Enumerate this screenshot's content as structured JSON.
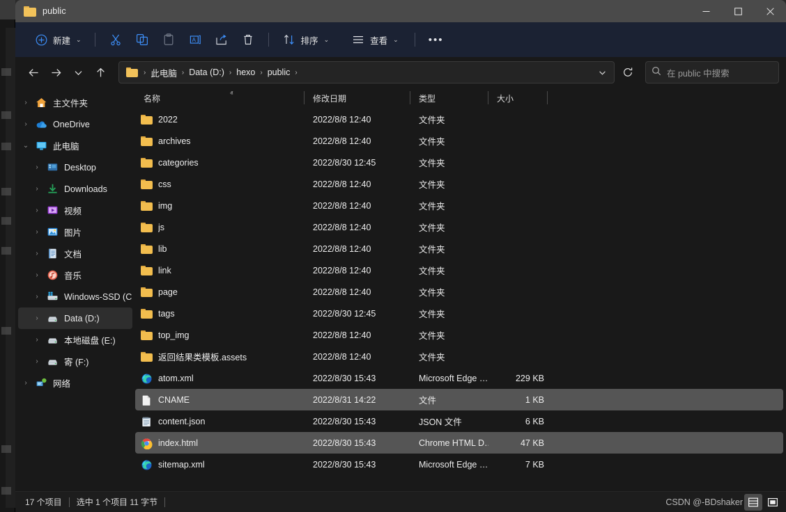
{
  "window": {
    "title": "public",
    "title_icon": "folder-icon",
    "controls": {
      "minimize": "—",
      "maximize": "□",
      "close": "✕"
    }
  },
  "toolbar": {
    "new_label": "新建",
    "new_icon": "plus-circle-icon",
    "cut_icon": "scissors-icon",
    "copy_icon": "copy-icon",
    "paste_icon": "paste-icon",
    "rename_icon": "rename-icon",
    "share_icon": "share-icon",
    "delete_icon": "trash-icon",
    "sort_label": "排序",
    "sort_icon": "sort-arrows-icon",
    "view_label": "查看",
    "view_icon": "view-lines-icon",
    "more_label": "•••",
    "chevron": "⌄"
  },
  "address": {
    "back_icon": "arrow-left-icon",
    "forward_icon": "arrow-right-icon",
    "recent_icon": "chevron-down-icon",
    "up_icon": "arrow-up-icon",
    "folder_icon": "folder-icon",
    "separator": "›",
    "crumbs": [
      "此电脑",
      "Data (D:)",
      "hexo",
      "public"
    ],
    "dropdown_icon": "chevron-down-icon",
    "refresh_icon": "refresh-icon",
    "search_icon": "search-icon",
    "search_placeholder": "在 public 中搜索",
    "search_value": ""
  },
  "sidebar": {
    "items": [
      {
        "label": "主文件夹",
        "icon": "home-icon",
        "level": 1,
        "expander": "›",
        "selected": false
      },
      {
        "label": "OneDrive",
        "icon": "onedrive-cloud-icon",
        "level": 1,
        "expander": "›",
        "selected": false
      },
      {
        "label": "此电脑",
        "icon": "this-pc-icon",
        "level": 1,
        "expander": "⌄",
        "selected": false
      },
      {
        "label": "Desktop",
        "icon": "desktop-icon",
        "level": 2,
        "expander": "›",
        "selected": false
      },
      {
        "label": "Downloads",
        "icon": "downloads-icon",
        "level": 2,
        "expander": "›",
        "selected": false
      },
      {
        "label": "视频",
        "icon": "videos-icon",
        "level": 2,
        "expander": "›",
        "selected": false
      },
      {
        "label": "图片",
        "icon": "pictures-icon",
        "level": 2,
        "expander": "›",
        "selected": false
      },
      {
        "label": "文档",
        "icon": "documents-icon",
        "level": 2,
        "expander": "›",
        "selected": false
      },
      {
        "label": "音乐",
        "icon": "music-icon",
        "level": 2,
        "expander": "›",
        "selected": false
      },
      {
        "label": "Windows-SSD (C",
        "icon": "windows-drive-icon",
        "level": 2,
        "expander": "›",
        "selected": false
      },
      {
        "label": "Data (D:)",
        "icon": "drive-icon",
        "level": 2,
        "expander": "›",
        "selected": true
      },
      {
        "label": "本地磁盘 (E:)",
        "icon": "drive-icon",
        "level": 2,
        "expander": "›",
        "selected": false
      },
      {
        "label": "寄 (F:)",
        "icon": "drive-icon",
        "level": 2,
        "expander": "›",
        "selected": false
      },
      {
        "label": "网络",
        "icon": "network-icon",
        "level": 1,
        "expander": "›",
        "selected": false
      }
    ]
  },
  "filelist": {
    "columns": [
      {
        "key": "name",
        "label": "名称",
        "sorted": true,
        "sort_caret": "ⱏ"
      },
      {
        "key": "date",
        "label": "修改日期"
      },
      {
        "key": "type",
        "label": "类型"
      },
      {
        "key": "size",
        "label": "大小"
      }
    ],
    "rows": [
      {
        "name": "2022",
        "date": "2022/8/8 12:40",
        "type": "文件夹",
        "size": "",
        "icon": "folder-icon",
        "selected": false
      },
      {
        "name": "archives",
        "date": "2022/8/8 12:40",
        "type": "文件夹",
        "size": "",
        "icon": "folder-icon",
        "selected": false
      },
      {
        "name": "categories",
        "date": "2022/8/30 12:45",
        "type": "文件夹",
        "size": "",
        "icon": "folder-icon",
        "selected": false
      },
      {
        "name": "css",
        "date": "2022/8/8 12:40",
        "type": "文件夹",
        "size": "",
        "icon": "folder-icon",
        "selected": false
      },
      {
        "name": "img",
        "date": "2022/8/8 12:40",
        "type": "文件夹",
        "size": "",
        "icon": "folder-icon",
        "selected": false
      },
      {
        "name": "js",
        "date": "2022/8/8 12:40",
        "type": "文件夹",
        "size": "",
        "icon": "folder-icon",
        "selected": false
      },
      {
        "name": "lib",
        "date": "2022/8/8 12:40",
        "type": "文件夹",
        "size": "",
        "icon": "folder-icon",
        "selected": false
      },
      {
        "name": "link",
        "date": "2022/8/8 12:40",
        "type": "文件夹",
        "size": "",
        "icon": "folder-icon",
        "selected": false
      },
      {
        "name": "page",
        "date": "2022/8/8 12:40",
        "type": "文件夹",
        "size": "",
        "icon": "folder-icon",
        "selected": false
      },
      {
        "name": "tags",
        "date": "2022/8/30 12:45",
        "type": "文件夹",
        "size": "",
        "icon": "folder-icon",
        "selected": false
      },
      {
        "name": "top_img",
        "date": "2022/8/8 12:40",
        "type": "文件夹",
        "size": "",
        "icon": "folder-icon",
        "selected": false
      },
      {
        "name": "返回结果类模板.assets",
        "date": "2022/8/8 12:40",
        "type": "文件夹",
        "size": "",
        "icon": "folder-icon",
        "selected": false
      },
      {
        "name": "atom.xml",
        "date": "2022/8/30 15:43",
        "type": "Microsoft Edge …",
        "size": "229 KB",
        "icon": "edge-icon",
        "selected": false
      },
      {
        "name": "CNAME",
        "date": "2022/8/31 14:22",
        "type": "文件",
        "size": "1 KB",
        "icon": "blank-file-icon",
        "selected": true
      },
      {
        "name": "content.json",
        "date": "2022/8/30 15:43",
        "type": "JSON 文件",
        "size": "6 KB",
        "icon": "notepad-icon",
        "selected": false
      },
      {
        "name": "index.html",
        "date": "2022/8/30 15:43",
        "type": "Chrome HTML D…",
        "size": "47 KB",
        "icon": "chrome-icon",
        "selected": true
      },
      {
        "name": "sitemap.xml",
        "date": "2022/8/30 15:43",
        "type": "Microsoft Edge …",
        "size": "7 KB",
        "icon": "edge-icon",
        "selected": false
      }
    ]
  },
  "statusbar": {
    "item_count": "17 个项目",
    "selection": "选中 1 个项目  11 字节",
    "watermark": "CSDN @-BDshaker",
    "view_details_icon": "details-view-icon",
    "view_large_icon": "large-icons-view-icon"
  },
  "colors": {
    "accent": "#3d8ef7",
    "toolbar_bg": "#1b2233",
    "window_bg": "#191919",
    "titlebar_bg": "#4a4a4a",
    "selection": "#555555",
    "folder": "#f2bd4e"
  }
}
